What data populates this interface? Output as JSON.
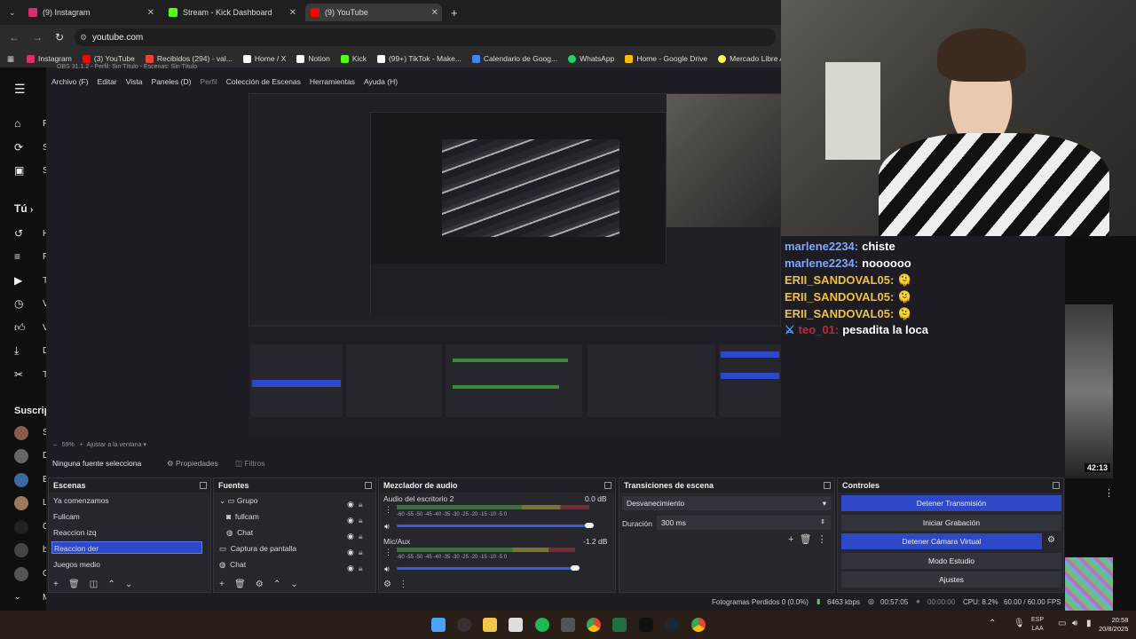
{
  "browser": {
    "tabs": [
      {
        "label": "(9) Instagram",
        "color": "#d6306e"
      },
      {
        "label": "Stream - Kick Dashboard",
        "color": "#53fc18"
      },
      {
        "label": "(9) YouTube",
        "color": "#ff0000"
      }
    ],
    "new_tab": "+",
    "url": "youtube.com",
    "bookmarks": [
      {
        "label": "Instagram",
        "color": "#d6306e"
      },
      {
        "label": "(3) YouTube",
        "color": "#ff0000"
      },
      {
        "label": "Recibidos (294) - val...",
        "color": "#ea4335"
      },
      {
        "label": "Home / X",
        "color": "#ffffff"
      },
      {
        "label": "Notion",
        "color": "#ffffff"
      },
      {
        "label": "Kick",
        "color": "#53fc18"
      },
      {
        "label": "(99+) TikTok - Make...",
        "color": "#ffffff"
      },
      {
        "label": "Calendario de Goog...",
        "color": "#4285f4"
      },
      {
        "label": "WhatsApp",
        "color": "#25d366"
      },
      {
        "label": "Home - Google Drive",
        "color": "#fbbc04"
      },
      {
        "label": "Mercado Libre Arge...",
        "color": "#fff159"
      }
    ]
  },
  "youtube_sidebar": {
    "letters": [
      "P",
      "S",
      "S",
      "H",
      "P",
      "T",
      "V",
      "V",
      "D",
      "T"
    ],
    "you_label": "Tú",
    "subs_label": "Suscrip",
    "sub_letters": [
      "S",
      "D",
      "E",
      "L",
      "C",
      "b",
      "C",
      "M"
    ]
  },
  "obs": {
    "window_title": "OBS 31.1.2 - Perfil: Sin Título - Escenas: Sin Título",
    "menu": [
      "Archivo (F)",
      "Editar",
      "Vista",
      "Paneles (D)",
      "Perfil",
      "Colección de Escenas",
      "Herramientas",
      "Ayuda (H)"
    ],
    "zoom_bar": {
      "zoom": "59%",
      "fit": "Ajustar a la ventana"
    },
    "source_bar": {
      "label": "Ninguna fuente selecciona",
      "props": "Propiedades",
      "filters": "Filtros"
    },
    "scenes": {
      "title": "Escenas",
      "items": [
        "Ya comenzamos",
        "Fullcam",
        "Reaccion izq",
        "Reaccion der",
        "Juegos medio"
      ],
      "selected": "Reaccion der"
    },
    "sources": {
      "title": "Fuentes",
      "items": [
        "Grupo",
        "fullcam",
        "Chat",
        "Captura de pantalla",
        "Chat"
      ]
    },
    "mixer": {
      "title": "Mezclador de audio",
      "channels": [
        {
          "name": "Audio del escritorio 2",
          "db": "0.0 dB",
          "level": 0.92
        },
        {
          "name": "Mic/Aux",
          "db": "-1.2 dB",
          "level": 0.85
        }
      ],
      "ticks": "-60 -55 -50 -45 -40 -35 -30 -25 -20 -15 -10 -5 0"
    },
    "transitions": {
      "title": "Transiciones de escena",
      "selected": "Desvanecimiento",
      "duration_label": "Duración",
      "duration_value": "300 ms"
    },
    "controls": {
      "title": "Controles",
      "buttons": [
        "Detener Transmisión",
        "Iniciar Grabación",
        "Detener Cámara Virtual",
        "Modo Estudio",
        "Ajustes"
      ]
    },
    "status": {
      "dropped": "Fotogramas Perdidos 0 (0.0%)",
      "bitrate": "6463 kbps",
      "live_time": "00:57:05",
      "rec_time": "00:00:00",
      "cpu": "CPU: 8.2%",
      "fps": "60.00 / 60.00 FPS"
    }
  },
  "chat": [
    {
      "user": "marlene2234:",
      "msg": "chiste",
      "color": "#7fa7ff"
    },
    {
      "user": "marlene2234:",
      "msg": "noooooo",
      "color": "#7fa7ff"
    },
    {
      "user": "ERII_SANDOVAL05:",
      "msg": "🫠",
      "color": "#f0c040"
    },
    {
      "user": "ERII_SANDOVAL05:",
      "msg": "🫠",
      "color": "#f0c040"
    },
    {
      "user": "ERII_SANDOVAL05:",
      "msg": "🫠",
      "color": "#f0c040"
    },
    {
      "user": "teo_01:",
      "msg": "pesadita la loca",
      "color": "#c02a3c"
    }
  ],
  "video_card": {
    "duration": "42:13"
  },
  "taskbar": {
    "lang": "ESP",
    "lang2": "LAA",
    "time": "20:58",
    "date": "20/8/2025"
  }
}
